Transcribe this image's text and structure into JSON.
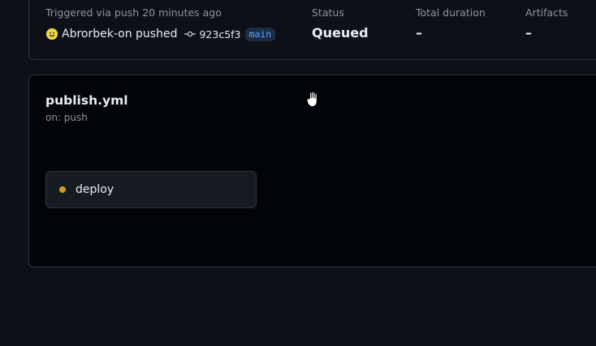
{
  "summary": {
    "trigger_text": "Triggered via push 20 minutes ago",
    "actor": "Abrorbek-on pushed",
    "commit_sha": "923c5f3",
    "branch": "main",
    "status_label": "Status",
    "status_value": "Queued",
    "duration_label": "Total duration",
    "duration_value": "–",
    "artifacts_label": "Artifacts",
    "artifacts_value": "–"
  },
  "workflow": {
    "file_name": "publish.yml",
    "trigger": "on: push",
    "jobs": [
      {
        "name": "deploy",
        "status": "queued",
        "status_color": "#d29922"
      }
    ]
  },
  "colors": {
    "background": "#0d1117",
    "graph_background": "#010409",
    "border": "#30363d",
    "muted_text": "#8b949e",
    "branch_text": "#58a6ff"
  },
  "icons": {
    "avatar": "avatar-smiley",
    "commit": "git-commit-icon",
    "cursor": "hand-cursor-icon"
  }
}
